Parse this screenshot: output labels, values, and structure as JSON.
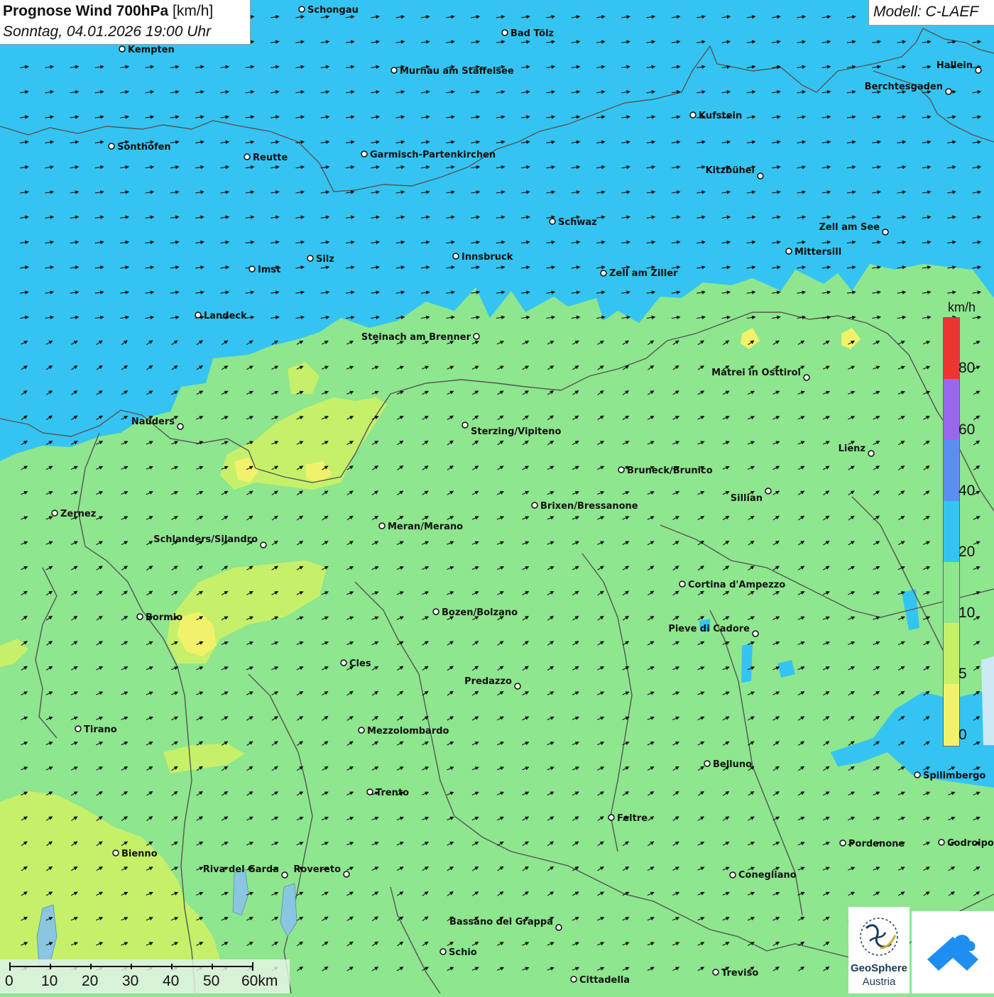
{
  "header": {
    "title_bold": "Prognose Wind 700hPa",
    "title_unit": "[km/h]",
    "date": "Sonntag, 04.01.2026 19:00 Uhr"
  },
  "model": {
    "label": "Modell: C-LAEF"
  },
  "legend": {
    "unit": "km/h",
    "bins": [
      {
        "from": 0,
        "to": 5,
        "color": "#f2f26a"
      },
      {
        "from": 5,
        "to": 10,
        "color": "#c6f06a"
      },
      {
        "from": 10,
        "to": 20,
        "color": "#8ee68e"
      },
      {
        "from": 20,
        "to": 40,
        "color": "#35c4f2"
      },
      {
        "from": 40,
        "to": 60,
        "color": "#5b8ef0"
      },
      {
        "from": 60,
        "to": 80,
        "color": "#9966ee"
      },
      {
        "from": 80,
        "to": 100,
        "color": "#ee3333"
      }
    ],
    "labels": [
      "80",
      "60",
      "40",
      "20",
      "10",
      "5",
      "0"
    ]
  },
  "scale_bar": {
    "labels": [
      "0",
      "10",
      "20",
      "30",
      "40",
      "50",
      "60km"
    ]
  },
  "logos": {
    "geosphere_line1": "GeoSphere",
    "geosphere_line2": "Austria",
    "cloud_icon": "weather-app-icon"
  },
  "cities": [
    {
      "name": "Schongau"
    },
    {
      "name": "Bad Tölz"
    },
    {
      "name": "Kempten"
    },
    {
      "name": "Murnau am Staffelsee"
    },
    {
      "name": "Hallein"
    },
    {
      "name": "Berchtesgaden"
    },
    {
      "name": "Kufstein"
    },
    {
      "name": "Sonthofen"
    },
    {
      "name": "Reutte"
    },
    {
      "name": "Garmisch-Partenkirchen"
    },
    {
      "name": "Kitzbühel"
    },
    {
      "name": "Schwaz"
    },
    {
      "name": "Zell am See"
    },
    {
      "name": "Mittersill"
    },
    {
      "name": "Imst"
    },
    {
      "name": "Silz"
    },
    {
      "name": "Innsbruck"
    },
    {
      "name": "Zell am Ziller"
    },
    {
      "name": "Landeck"
    },
    {
      "name": "Steinach am Brenner"
    },
    {
      "name": "Matrei in Osttirol"
    },
    {
      "name": "Nauders"
    },
    {
      "name": "Sterzing/Vipiteno"
    },
    {
      "name": "Lienz"
    },
    {
      "name": "Bruneck/Brunico"
    },
    {
      "name": "Sillian"
    },
    {
      "name": "Zernez"
    },
    {
      "name": "Brixen/Bressanone"
    },
    {
      "name": "Meran/Merano"
    },
    {
      "name": "Schlanders/Silandro"
    },
    {
      "name": "Cortina d'Ampezzo"
    },
    {
      "name": "Bormio"
    },
    {
      "name": "Bozen/Bolzano"
    },
    {
      "name": "Pieve di Cadore"
    },
    {
      "name": "Cles"
    },
    {
      "name": "Predazzo"
    },
    {
      "name": "Tirano"
    },
    {
      "name": "Mezzolombardo"
    },
    {
      "name": "Belluno"
    },
    {
      "name": "Spilimbergo"
    },
    {
      "name": "Trento"
    },
    {
      "name": "Feltre"
    },
    {
      "name": "Pordenone"
    },
    {
      "name": "Codroipo"
    },
    {
      "name": "Bienno"
    },
    {
      "name": "Riva del Garda"
    },
    {
      "name": "Rovereto"
    },
    {
      "name": "Conegliano"
    },
    {
      "name": "Bassano del Grappa"
    },
    {
      "name": "Schio"
    },
    {
      "name": "Treviso"
    },
    {
      "name": "Cittadella"
    }
  ]
}
